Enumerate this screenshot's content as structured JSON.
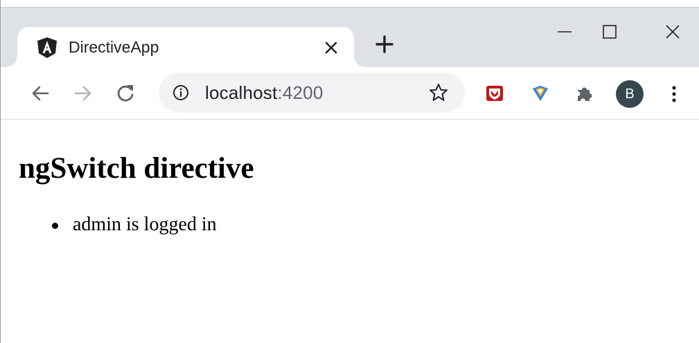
{
  "browser": {
    "tab": {
      "title": "DirectiveApp",
      "favicon": "angular-logo-icon"
    },
    "new_tab_icon": "plus-icon",
    "window_controls": [
      "minimize-icon",
      "maximize-icon",
      "close-icon"
    ],
    "address_bar": {
      "host": "localhost",
      "port": ":4200"
    },
    "profile_avatar": "B",
    "extensions": [
      "mcafee-shield-icon",
      "vpn-extension-icon",
      "puzzle-extensions-icon"
    ],
    "colors": {
      "tabstrip": "#dee1e6",
      "omnibox": "#f1f3f4",
      "icon": "#5f6368",
      "avatar": "#37474f"
    }
  },
  "page": {
    "heading": "ngSwitch directive",
    "items": [
      {
        "text": "admin is logged in"
      }
    ]
  }
}
